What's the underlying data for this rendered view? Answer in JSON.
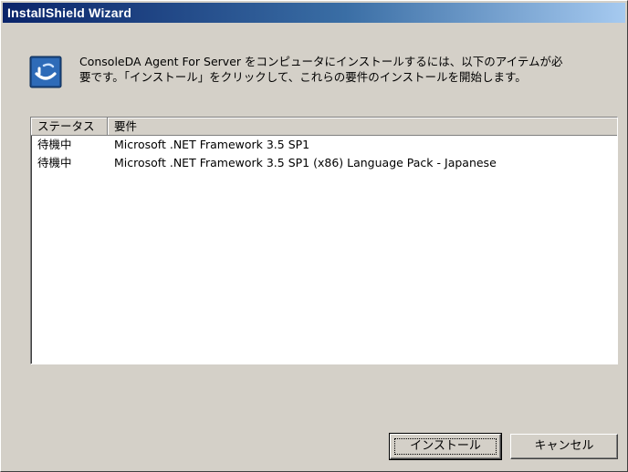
{
  "window": {
    "title": "InstallShield Wizard"
  },
  "header": {
    "icon": "installshield-icon",
    "message": "ConsoleDA Agent For Server をコンピュータにインストールするには、以下のアイテムが必\n要です。「インストール」をクリックして、これらの要件のインストールを開始します。"
  },
  "list": {
    "columns": [
      "ステータス",
      "要件"
    ],
    "rows": [
      {
        "status": "待機中",
        "requirement": "Microsoft .NET Framework 3.5 SP1"
      },
      {
        "status": "待機中",
        "requirement": "Microsoft .NET Framework 3.5 SP1 (x86) Language Pack - Japanese"
      }
    ]
  },
  "buttons": {
    "install": "インストール",
    "cancel": "キャンセル"
  },
  "colors": {
    "title_start": "#0a246a",
    "title_end": "#a6caf0",
    "dialog_bg": "#d4d0c8"
  }
}
